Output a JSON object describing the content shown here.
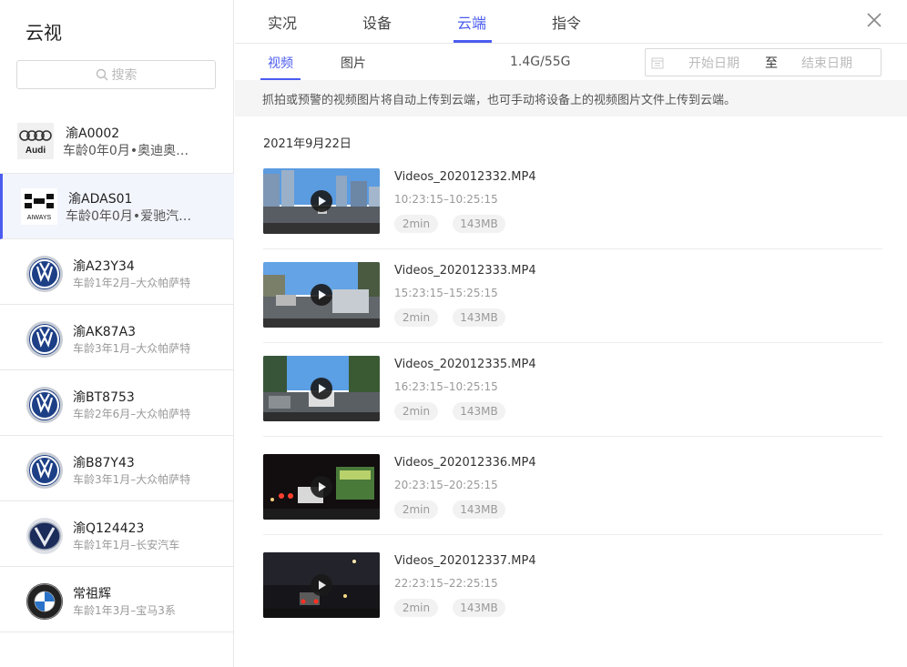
{
  "sidebar": {
    "title": "云视",
    "search_placeholder": "搜索",
    "vehicles": [
      {
        "plate": "渝A0002",
        "desc": "车龄0年0月•奥迪奥…",
        "logo": "audi-logo"
      },
      {
        "plate": "渝ADAS01",
        "desc": "车龄0年0月•爱驰汽…",
        "logo": "aiways-logo",
        "active": true
      },
      {
        "plate": "渝A23Y34",
        "desc": "车龄1年2月–大众帕萨特",
        "logo": "volkswagen-logo"
      },
      {
        "plate": "渝AK87A3",
        "desc": "车龄3年1月–大众帕萨特",
        "logo": "volkswagen-logo"
      },
      {
        "plate": "渝BT8753",
        "desc": "车龄2年6月–大众帕萨特",
        "logo": "volkswagen-logo"
      },
      {
        "plate": "渝B87Y43",
        "desc": "车龄3年1月–大众帕萨特",
        "logo": "volkswagen-logo"
      },
      {
        "plate": "渝Q124423",
        "desc": "车龄1年1月–长安汽车",
        "logo": "changan-logo"
      },
      {
        "plate": "常祖辉",
        "desc": "车龄1年3月–宝马3系",
        "logo": "bmw-logo"
      }
    ]
  },
  "tabs": [
    {
      "label": "实况"
    },
    {
      "label": "设备"
    },
    {
      "label": "云端",
      "active": true
    },
    {
      "label": "指令"
    }
  ],
  "subtabs": [
    {
      "label": "视频",
      "active": true
    },
    {
      "label": "图片"
    }
  ],
  "storage": "1.4G/55G",
  "date_range": {
    "start_placeholder": "开始日期",
    "separator": "至",
    "end_placeholder": "结束日期"
  },
  "notice": "抓拍或预警的视频图片将自动上传到云端，也可手动将设备上的视频图片文件上传到云端。",
  "date_header": "2021年9月22日",
  "videos": [
    {
      "name": "Videos_202012332.MP4",
      "time": "10:23:15–10:25:15",
      "duration": "2min",
      "size": "143MB"
    },
    {
      "name": "Videos_202012333.MP4",
      "time": "15:23:15–15:25:15",
      "duration": "2min",
      "size": "143MB"
    },
    {
      "name": "Videos_202012335.MP4",
      "time": "16:23:15–10:25:15",
      "duration": "2min",
      "size": "143MB"
    },
    {
      "name": "Videos_202012336.MP4",
      "time": "20:23:15–20:25:15",
      "duration": "2min",
      "size": "143MB"
    },
    {
      "name": "Videos_202012337.MP4",
      "time": "22:23:15–22:25:15",
      "duration": "2min",
      "size": "143MB"
    }
  ],
  "colors": {
    "accent": "#4b5cf0",
    "active_row_bg": "#f3f5fd"
  }
}
